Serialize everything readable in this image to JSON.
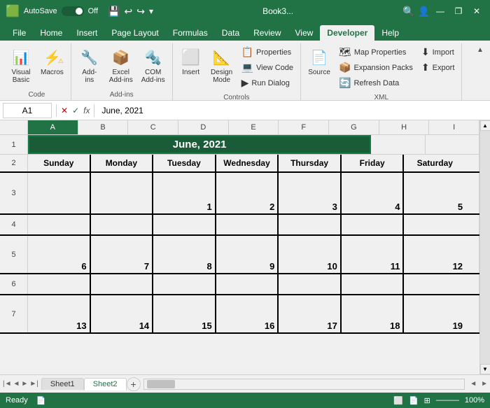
{
  "titleBar": {
    "autosave": "AutoSave",
    "toggleState": "Off",
    "fileName": "Book3...",
    "searchPlaceholder": "🔍",
    "winBtns": [
      "—",
      "❐",
      "✕"
    ]
  },
  "ribbonTabs": [
    "File",
    "Home",
    "Insert",
    "Page Layout",
    "Formulas",
    "Data",
    "Review",
    "View",
    "Developer",
    "Help"
  ],
  "activeTab": "Developer",
  "ribbonGroups": [
    {
      "name": "Code",
      "label": "Code",
      "buttons": [
        {
          "id": "visual-basic",
          "icon": "📊",
          "label": "Visual\nBasic"
        },
        {
          "id": "macros",
          "icon": "⚡",
          "label": "Macros"
        }
      ]
    },
    {
      "name": "Add-ins",
      "label": "Add-ins",
      "buttons": [
        {
          "id": "add-ins",
          "icon": "🔧",
          "label": "Add-\nins"
        },
        {
          "id": "excel-add-ins",
          "icon": "📦",
          "label": "Excel\nAdd-ins"
        },
        {
          "id": "com-add-ins",
          "icon": "🔩",
          "label": "COM\nAdd-ins"
        }
      ]
    },
    {
      "name": "Controls",
      "label": "Controls",
      "buttons": [
        {
          "id": "insert-ctrl",
          "icon": "⬜",
          "label": "Insert"
        },
        {
          "id": "design-mode",
          "icon": "📐",
          "label": "Design\nMode"
        }
      ],
      "smallButtons": [
        {
          "id": "properties",
          "icon": "📋",
          "label": "Properties"
        },
        {
          "id": "view-code",
          "icon": "💻",
          "label": "View Code"
        },
        {
          "id": "run-dialog",
          "icon": "▶",
          "label": "Run Dialog"
        }
      ]
    },
    {
      "name": "XML",
      "label": "XML",
      "buttons": [
        {
          "id": "source",
          "icon": "📄",
          "label": "Source"
        }
      ],
      "smallButtons": [
        {
          "id": "map-properties",
          "icon": "🗺",
          "label": "Map Properties"
        },
        {
          "id": "expansion-packs",
          "icon": "📦",
          "label": "Expansion Packs"
        },
        {
          "id": "refresh-data",
          "icon": "🔄",
          "label": "Refresh Data"
        }
      ],
      "importExport": [
        {
          "id": "import",
          "icon": "⬇",
          "label": "Import"
        },
        {
          "id": "export",
          "icon": "⬆",
          "label": "Export"
        }
      ]
    }
  ],
  "formulaBar": {
    "nameBox": "A1",
    "formula": "June, 2021",
    "icons": [
      "✕",
      "✓",
      "fx"
    ]
  },
  "columns": [
    "A",
    "B",
    "C",
    "D",
    "E",
    "F",
    "G",
    "H",
    "I"
  ],
  "rows": [
    "1",
    "2",
    "3",
    "4",
    "5",
    "6",
    "7"
  ],
  "calendar": {
    "title": "June, 2021",
    "days": [
      "Sunday",
      "Monday",
      "Tuesday",
      "Wednesday",
      "Thursday",
      "Friday",
      "Saturday"
    ],
    "weeks": [
      [
        null,
        null,
        1,
        2,
        3,
        4,
        5
      ],
      [
        6,
        7,
        8,
        9,
        10,
        11,
        12
      ],
      [
        13,
        14,
        15,
        16,
        17,
        18,
        19
      ]
    ]
  },
  "sheetTabs": [
    "Sheet1",
    "Sheet2"
  ],
  "activeSheet": "Sheet2",
  "statusBar": {
    "left": "Ready",
    "right": ""
  }
}
